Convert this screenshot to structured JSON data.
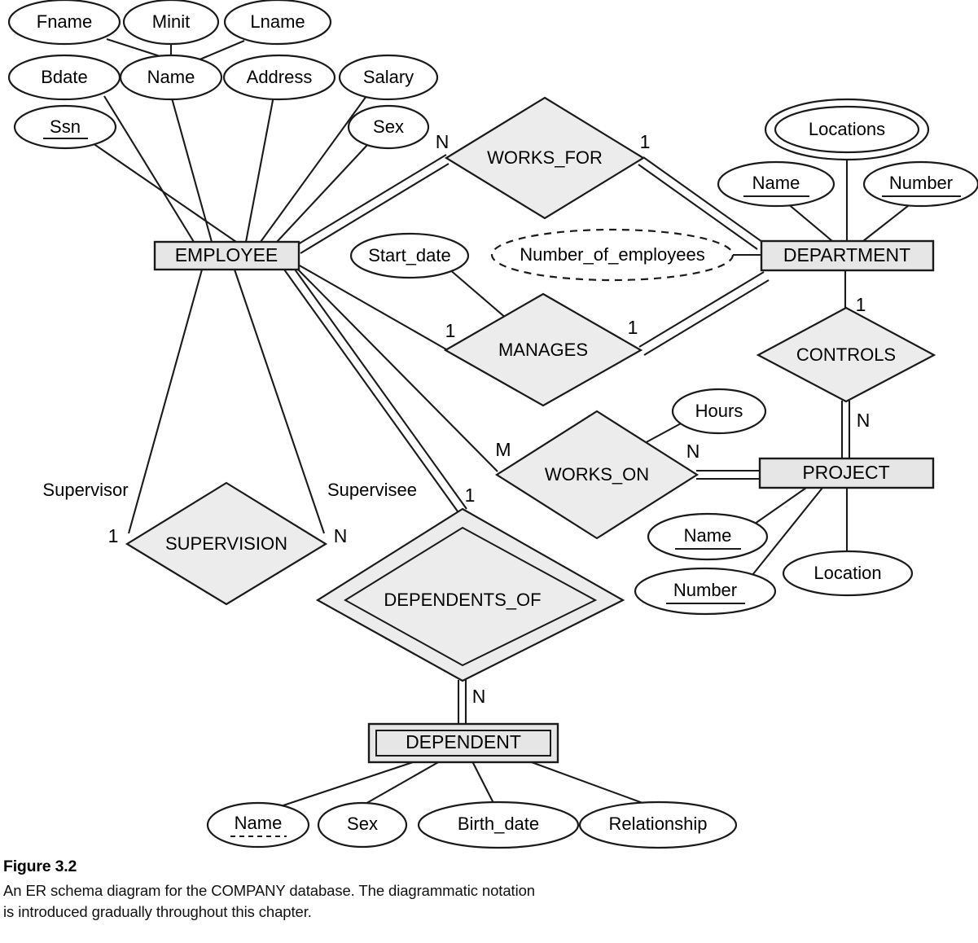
{
  "figure": {
    "title": "Figure 3.2",
    "caption_line1": "An ER schema diagram for the COMPANY database. The diagrammatic notation",
    "caption_line2": "is introduced gradually throughout this chapter."
  },
  "colors": {
    "entity_fill": "#e6e6e6",
    "relationship_fill": "#ececec",
    "attribute_fill": "#ffffff",
    "stroke": "#1a1a1a",
    "background": "#ffffff"
  },
  "diagram": {
    "name": "COMPANY ER schema diagram",
    "entities": [
      {
        "id": "employee",
        "label": "EMPLOYEE",
        "kind": "strong"
      },
      {
        "id": "department",
        "label": "DEPARTMENT",
        "kind": "strong"
      },
      {
        "id": "project",
        "label": "PROJECT",
        "kind": "strong"
      },
      {
        "id": "dependent",
        "label": "DEPENDENT",
        "kind": "weak"
      }
    ],
    "relationships": [
      {
        "id": "works_for",
        "label": "WORKS_FOR",
        "kind": "normal",
        "participants": [
          "EMPLOYEE",
          "DEPARTMENT"
        ],
        "cardinality": [
          "N",
          "1"
        ]
      },
      {
        "id": "manages",
        "label": "MANAGES",
        "kind": "normal",
        "participants": [
          "EMPLOYEE",
          "DEPARTMENT"
        ],
        "cardinality": [
          "1",
          "1"
        ]
      },
      {
        "id": "controls",
        "label": "CONTROLS",
        "kind": "normal",
        "participants": [
          "DEPARTMENT",
          "PROJECT"
        ],
        "cardinality": [
          "1",
          "N"
        ]
      },
      {
        "id": "works_on",
        "label": "WORKS_ON",
        "kind": "normal",
        "participants": [
          "EMPLOYEE",
          "PROJECT"
        ],
        "cardinality": [
          "M",
          "N"
        ]
      },
      {
        "id": "supervision",
        "label": "SUPERVISION",
        "kind": "normal",
        "participants": [
          "EMPLOYEE",
          "EMPLOYEE"
        ],
        "cardinality": [
          "1",
          "N"
        ]
      },
      {
        "id": "dependents_of",
        "label": "DEPENDENTS_OF",
        "kind": "identifying",
        "participants": [
          "EMPLOYEE",
          "DEPENDENT"
        ],
        "cardinality": [
          "1",
          "N"
        ]
      }
    ],
    "attributes": {
      "employee": [
        {
          "label": "Fname",
          "kind": "simple"
        },
        {
          "label": "Minit",
          "kind": "simple"
        },
        {
          "label": "Lname",
          "kind": "simple"
        },
        {
          "label": "Name",
          "kind": "composite"
        },
        {
          "label": "Bdate",
          "kind": "simple"
        },
        {
          "label": "Address",
          "kind": "simple"
        },
        {
          "label": "Salary",
          "kind": "simple"
        },
        {
          "label": "Ssn",
          "kind": "key"
        },
        {
          "label": "Sex",
          "kind": "simple"
        }
      ],
      "department": [
        {
          "label": "Locations",
          "kind": "multivalued"
        },
        {
          "label": "Name",
          "kind": "key"
        },
        {
          "label": "Number",
          "kind": "key"
        },
        {
          "label": "Number_of_employees",
          "kind": "derived"
        }
      ],
      "project": [
        {
          "label": "Name",
          "kind": "key"
        },
        {
          "label": "Number",
          "kind": "key"
        },
        {
          "label": "Location",
          "kind": "simple"
        }
      ],
      "dependent": [
        {
          "label": "Name",
          "kind": "partial-key"
        },
        {
          "label": "Sex",
          "kind": "simple"
        },
        {
          "label": "Birth_date",
          "kind": "simple"
        },
        {
          "label": "Relationship",
          "kind": "simple"
        }
      ],
      "manages": [
        {
          "label": "Start_date",
          "kind": "simple"
        }
      ],
      "works_on": [
        {
          "label": "Hours",
          "kind": "simple"
        }
      ]
    },
    "roles": [
      {
        "label": "Supervisor",
        "relationship": "SUPERVISION"
      },
      {
        "label": "Supervisee",
        "relationship": "SUPERVISION"
      }
    ],
    "cardinality_labels": {
      "works_for_employee": "N",
      "works_for_department": "1",
      "manages_employee": "1",
      "manages_department": "1",
      "controls_department": "1",
      "controls_project": "N",
      "works_on_employee": "M",
      "works_on_project": "N",
      "supervision_supervisor": "1",
      "supervision_supervisee": "N",
      "dependents_of_employee": "1",
      "dependents_of_dependent": "N"
    }
  }
}
